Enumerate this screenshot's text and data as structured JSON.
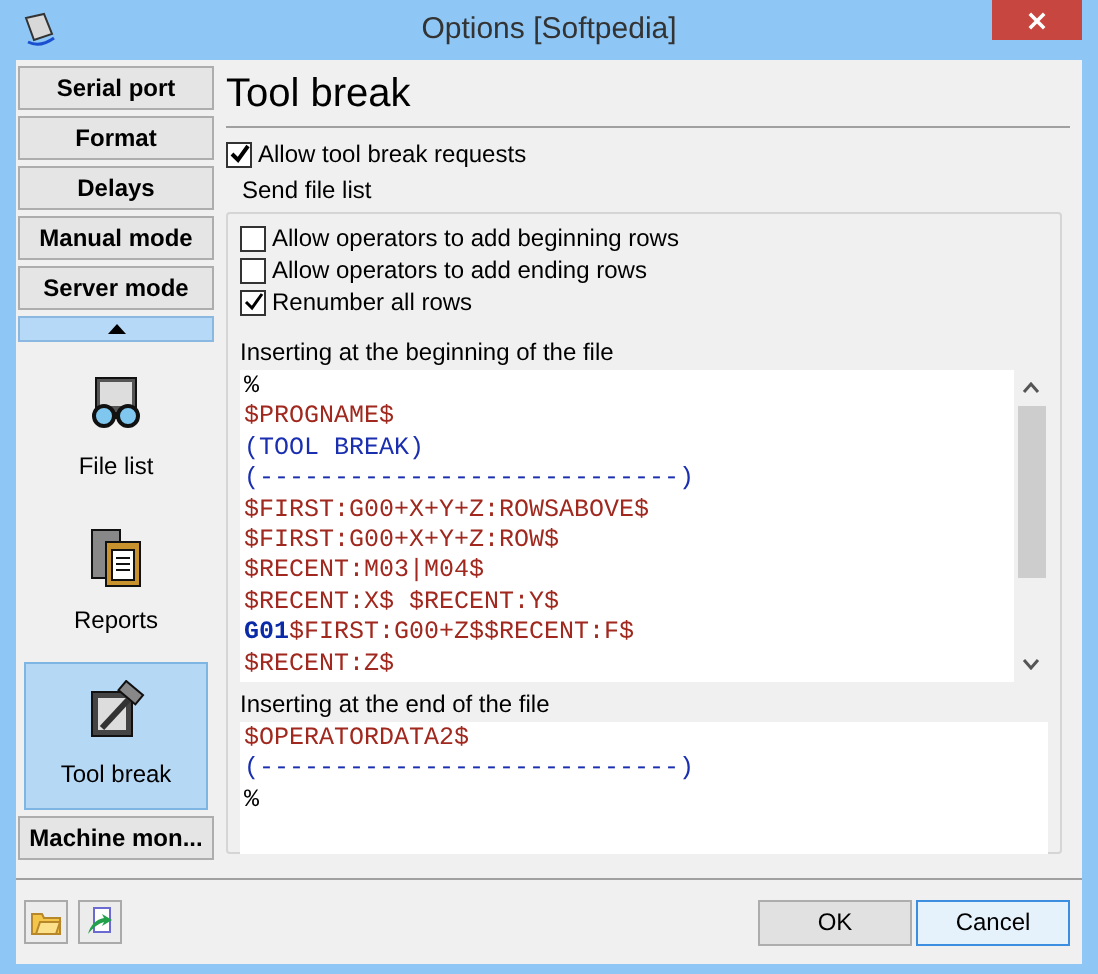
{
  "window": {
    "title": "Options [Softpedia]"
  },
  "sidebar": {
    "items": [
      {
        "kind": "button",
        "label": "Serial port",
        "selected": false
      },
      {
        "kind": "button",
        "label": "Format",
        "selected": false
      },
      {
        "kind": "button",
        "label": "Delays",
        "selected": false
      },
      {
        "kind": "button",
        "label": "Manual mode",
        "selected": false
      },
      {
        "kind": "button",
        "label": "Server mode",
        "selected": false
      },
      {
        "kind": "scroll_up"
      },
      {
        "kind": "tile",
        "label": "File list",
        "selected": false
      },
      {
        "kind": "tile",
        "label": "Reports",
        "selected": false
      },
      {
        "kind": "tile",
        "label": "Tool break",
        "selected": true
      },
      {
        "kind": "button",
        "label": "Machine mon...",
        "selected": false
      }
    ]
  },
  "page": {
    "title": "Tool break",
    "allow_checkbox": {
      "label": "Allow tool break requests",
      "checked": true
    },
    "group": {
      "title": "Send file list",
      "checkboxes": [
        {
          "label": "Allow operators to add beginning rows",
          "checked": false
        },
        {
          "label": "Allow operators to add ending rows",
          "checked": false
        },
        {
          "label": "Renumber all rows",
          "checked": true
        }
      ],
      "editors": [
        {
          "label": "Inserting at the beginning of the file",
          "scrollbar": true,
          "lines": [
            [
              {
                "kind": "plain",
                "text": "%"
              }
            ],
            [
              {
                "kind": "variable",
                "text": "$PROGNAME$"
              }
            ],
            [
              {
                "kind": "comment",
                "text": "(TOOL BREAK)"
              }
            ],
            [
              {
                "kind": "comment",
                "text": "(----------------------------)"
              }
            ],
            [
              {
                "kind": "variable",
                "text": "$FIRST:G00+X+Y+Z:ROWSABOVE$"
              }
            ],
            [
              {
                "kind": "variable",
                "text": "$FIRST:G00+X+Y+Z:ROW$"
              }
            ],
            [
              {
                "kind": "variable",
                "text": "$RECENT:M03|M04$"
              }
            ],
            [
              {
                "kind": "variable",
                "text": "$RECENT:X$ $RECENT:Y$"
              }
            ],
            [
              {
                "kind": "gcode",
                "text": "G01"
              },
              {
                "kind": "variable",
                "text": "$FIRST:G00+Z$$RECENT:F$"
              }
            ],
            [
              {
                "kind": "variable",
                "text": "$RECENT:Z$"
              }
            ]
          ]
        },
        {
          "label": "Inserting at the end of the file",
          "scrollbar": false,
          "lines": [
            [
              {
                "kind": "variable",
                "text": "$OPERATORDATA2$"
              }
            ],
            [
              {
                "kind": "comment",
                "text": "(----------------------------)"
              }
            ],
            [
              {
                "kind": "plain",
                "text": "%"
              }
            ]
          ]
        }
      ]
    }
  },
  "footer": {
    "buttons": [
      {
        "label": "OK",
        "focused": false
      },
      {
        "label": "Cancel",
        "focused": true
      }
    ]
  }
}
